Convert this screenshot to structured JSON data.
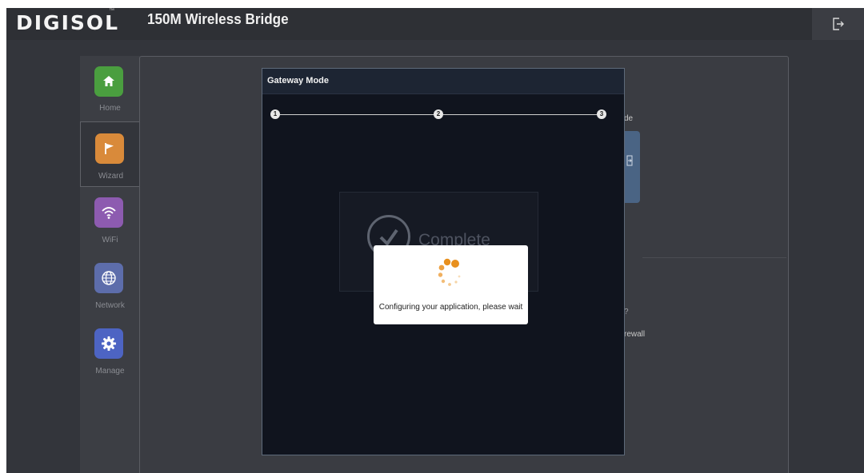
{
  "header": {
    "logo": "DIGISOL",
    "logo_tm": "™",
    "title": "150M Wireless Bridge",
    "logout_icon": "logout-icon"
  },
  "sidebar": {
    "items": [
      {
        "label": "Home",
        "icon": "home-icon",
        "color": "#4a9e3f"
      },
      {
        "label": "Wizard",
        "icon": "flag-icon",
        "color": "#d98a3a",
        "active": true
      },
      {
        "label": "WiFi",
        "icon": "wifi-icon",
        "color": "#8d5bb0"
      },
      {
        "label": "Network",
        "icon": "globe-icon",
        "color": "#5d6dab"
      },
      {
        "label": "Manage",
        "icon": "gear-icon",
        "color": "#4d64c3"
      }
    ]
  },
  "background_fragments": {
    "mode_suffix": "de",
    "question_mark": "?",
    "firewall_suffix": "rewall"
  },
  "modal": {
    "title": "Gateway Mode",
    "steps": [
      "1",
      "2",
      "3"
    ],
    "complete_text": "Complete"
  },
  "loading": {
    "message": "Configuring your application, please wait",
    "accent_color": "#e8901e"
  }
}
